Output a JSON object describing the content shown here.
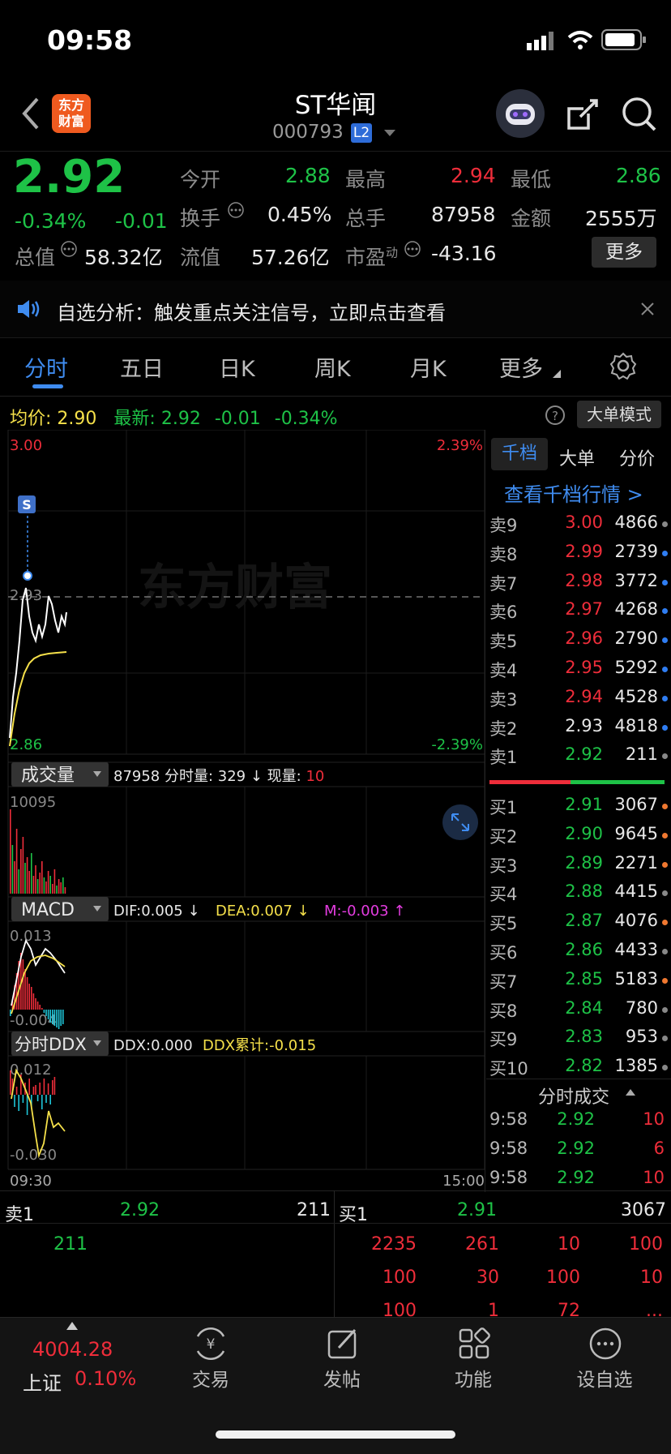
{
  "status": {
    "time": "09:58"
  },
  "header": {
    "title": "ST华闻",
    "code": "000793",
    "level": "L2",
    "logo_text_1": "东方",
    "logo_text_2": "财富"
  },
  "quote": {
    "price": "2.92",
    "change_pct": "-0.34%",
    "change": "-0.01",
    "open_label": "今开",
    "open": "2.88",
    "high_label": "最高",
    "high": "2.94",
    "low_label": "最低",
    "low": "2.86",
    "turnover_label": "换手",
    "turnover": "0.45%",
    "volume_label": "总手",
    "volume": "87958",
    "amount_label": "金额",
    "amount": "2555万",
    "mktcap_label": "总值",
    "mktcap": "58.32亿",
    "float_label": "流值",
    "float": "57.26亿",
    "pe_label": "市盈",
    "pe_sup": "动",
    "pe": "-43.16",
    "more_label": "更多"
  },
  "notice": {
    "text": "自选分析：触发重点关注信号，立即点击查看"
  },
  "tabs": [
    "分时",
    "五日",
    "日K",
    "周K",
    "月K",
    "更多"
  ],
  "info_line": {
    "avg_label": "均价:",
    "avg": "2.90",
    "latest_label": "最新:",
    "latest": "2.92",
    "chg": "-0.01",
    "pct": "-0.34%",
    "mode_label": "大单模式"
  },
  "chart_labels": {
    "price_top": "3.00",
    "price_mid": "2.93",
    "price_bot": "2.86",
    "pct_top": "2.39%",
    "pct_bot": "-2.39%",
    "vol_label": "成交量",
    "vol_info_a": "87958 分时量: 329 ↓ 现量: ",
    "vol_now": "10",
    "vol_max": "10095",
    "macd_label": "MACD",
    "dif": "DIF:0.005 ↓",
    "dea": "DEA:0.007 ↓",
    "m": "M:-0.003 ↑",
    "macd_top": "0.013",
    "macd_bot": "-0.004",
    "ddx_label": "分时DDX",
    "ddx": "DDX:0.000",
    "ddx_cum": "DDX累计:-0.015",
    "ddx_top": "0.012",
    "ddx_bot": "-0.030",
    "time_start": "09:30",
    "time_end": "15:00",
    "watermark": "东方财富",
    "signal": "S"
  },
  "book_tabs": [
    "千档",
    "大单",
    "分价"
  ],
  "book_link": "查看千档行情 >",
  "asks": [
    {
      "n": "卖9",
      "p": "3.00",
      "v": "4866",
      "dot": "#888888"
    },
    {
      "n": "卖8",
      "p": "2.99",
      "v": "2739",
      "dot": "#2f7df2"
    },
    {
      "n": "卖7",
      "p": "2.98",
      "v": "3772",
      "dot": "#2f7df2"
    },
    {
      "n": "卖6",
      "p": "2.97",
      "v": "4268",
      "dot": "#2f7df2"
    },
    {
      "n": "卖5",
      "p": "2.96",
      "v": "2790",
      "dot": "#2f7df2"
    },
    {
      "n": "卖4",
      "p": "2.95",
      "v": "5292",
      "dot": "#2f7df2"
    },
    {
      "n": "卖3",
      "p": "2.94",
      "v": "4528",
      "dot": "#2f7df2"
    },
    {
      "n": "卖2",
      "p": "2.93",
      "v": "4818",
      "dot": "#2f7df2"
    },
    {
      "n": "卖1",
      "p": "2.92",
      "v": "211",
      "dot": "#888888"
    }
  ],
  "bids": [
    {
      "n": "买1",
      "p": "2.91",
      "v": "3067",
      "dot": "#f07830"
    },
    {
      "n": "买2",
      "p": "2.90",
      "v": "9645",
      "dot": "#f07830"
    },
    {
      "n": "买3",
      "p": "2.89",
      "v": "2271",
      "dot": "#f07830"
    },
    {
      "n": "买4",
      "p": "2.88",
      "v": "4415",
      "dot": "#888888"
    },
    {
      "n": "买5",
      "p": "2.87",
      "v": "4076",
      "dot": "#f07830"
    },
    {
      "n": "买6",
      "p": "2.86",
      "v": "4433",
      "dot": "#888888"
    },
    {
      "n": "买7",
      "p": "2.85",
      "v": "5183",
      "dot": "#f07830"
    },
    {
      "n": "买8",
      "p": "2.84",
      "v": "780",
      "dot": "#888888"
    },
    {
      "n": "买9",
      "p": "2.83",
      "v": "953",
      "dot": "#888888"
    },
    {
      "n": "买10",
      "p": "2.82",
      "v": "1385",
      "dot": "#888888"
    }
  ],
  "trades_title": "分时成交",
  "trades": [
    {
      "t": "9:58",
      "p": "2.92",
      "v": "10"
    },
    {
      "t": "9:58",
      "p": "2.92",
      "v": "6"
    },
    {
      "t": "9:58",
      "p": "2.92",
      "v": "10"
    }
  ],
  "queue": {
    "sell_label": "卖1",
    "sell_price": "2.92",
    "sell_vol": "211",
    "buy_label": "买1",
    "buy_price": "2.91",
    "buy_vol": "3067",
    "sell_orders": [
      "211"
    ],
    "buy_rows": [
      [
        "2235",
        "261",
        "10",
        "100"
      ],
      [
        "100",
        "30",
        "100",
        "10"
      ],
      [
        "100",
        "1",
        "72",
        "..."
      ]
    ]
  },
  "bottom": {
    "index_value": "4004.28",
    "index_name": "上证",
    "index_pct": "0.10%",
    "items": [
      "交易",
      "发帖",
      "功能",
      "设自选"
    ]
  },
  "colors": {
    "up": "#ee2d3a",
    "down": "#1ec247",
    "accent": "#2f7df2",
    "avg_line": "#f5e04a"
  }
}
